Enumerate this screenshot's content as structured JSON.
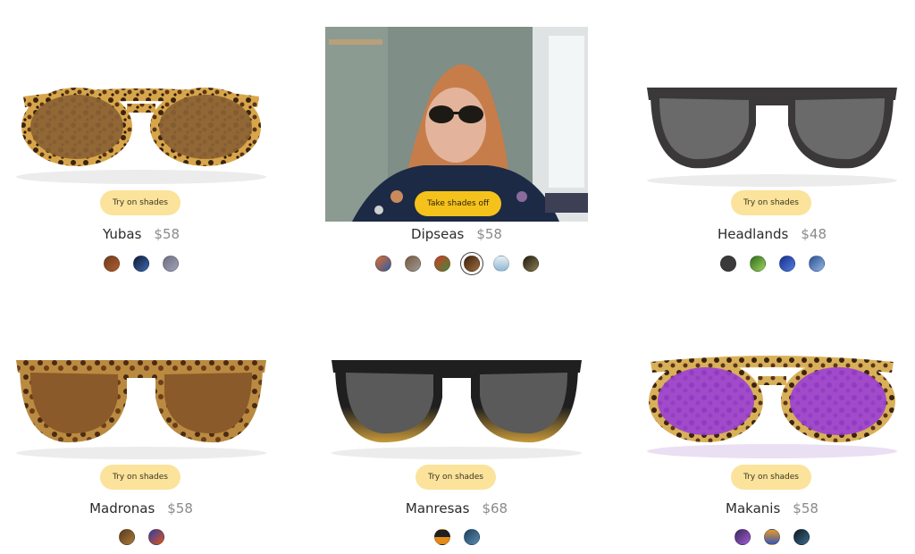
{
  "products": [
    {
      "name": "Yubas",
      "price": "$58",
      "button": "Try on shades",
      "swatches": [
        "#6b3f22",
        "#1e2b49",
        "#7a7c8a"
      ]
    },
    {
      "name": "Dipseas",
      "price": "$58",
      "button": "Take shades off",
      "swatches": [
        "#2a5ea8",
        "#8a7a6a",
        "#3e8a3a",
        "#6b4525",
        "#a9c9e0",
        "#4a4a2e"
      ],
      "selected_swatch": 3
    },
    {
      "name": "Headlands",
      "price": "$48",
      "button": "Try on shades",
      "swatches": [
        "#3a3a3a",
        "#7bc043",
        "#2f4fb5",
        "#5b86c9"
      ]
    },
    {
      "name": "Madronas",
      "price": "$58",
      "button": "Try on shades",
      "swatches": [
        "#6b4a26",
        "#d44a1c"
      ]
    },
    {
      "name": "Manresas",
      "price": "$68",
      "button": "Try on shades",
      "swatches": [
        "#1f1f1f",
        "#2a5d7a"
      ]
    },
    {
      "name": "Makanis",
      "price": "$58",
      "button": "Try on shades",
      "swatches": [
        "#5a3a7a",
        "#3a56b0",
        "#1f3a4a"
      ]
    }
  ],
  "colors": {
    "button_bg": "#fbe39b",
    "button_active_bg": "#f5c21b"
  }
}
